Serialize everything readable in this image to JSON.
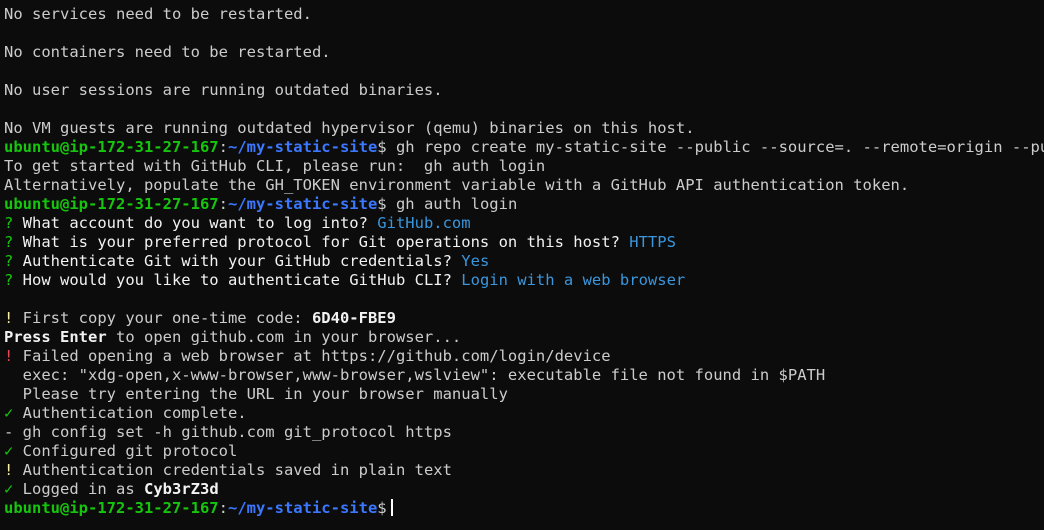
{
  "terminal": {
    "colors": {
      "text": "#cccccc",
      "prompt_user": "#16c60c",
      "prompt_path": "#3b78ff",
      "accent": "#3a96dd",
      "bright": "#f2f2f2",
      "warn": "#f9f1a5",
      "error": "#e74856"
    },
    "lines": [
      [
        {
          "t": "No services need to be restarted.",
          "c": "text"
        }
      ],
      [
        {
          "t": "",
          "c": "text"
        }
      ],
      [
        {
          "t": "No containers need to be restarted.",
          "c": "text"
        }
      ],
      [
        {
          "t": "",
          "c": "text"
        }
      ],
      [
        {
          "t": "No user sessions are running outdated binaries.",
          "c": "text"
        }
      ],
      [
        {
          "t": "",
          "c": "text"
        }
      ],
      [
        {
          "t": "No VM guests are running outdated hypervisor (qemu) binaries on this host.",
          "c": "text"
        }
      ],
      [
        {
          "t": "ubuntu@ip-172-31-27-167",
          "c": "prompt_user",
          "b": true
        },
        {
          "t": ":",
          "c": "text"
        },
        {
          "t": "~/my-static-site",
          "c": "prompt_path",
          "b": true
        },
        {
          "t": "$ gh repo create my-static-site --public --source=. --remote=origin --push",
          "c": "text"
        }
      ],
      [
        {
          "t": "To get started with GitHub CLI, please run:  gh auth login",
          "c": "text"
        }
      ],
      [
        {
          "t": "Alternatively, populate the GH_TOKEN environment variable with a GitHub API authentication token.",
          "c": "text"
        }
      ],
      [
        {
          "t": "ubuntu@ip-172-31-27-167",
          "c": "prompt_user",
          "b": true
        },
        {
          "t": ":",
          "c": "text"
        },
        {
          "t": "~/my-static-site",
          "c": "prompt_path",
          "b": true
        },
        {
          "t": "$ gh auth login",
          "c": "text"
        }
      ],
      [
        {
          "t": "? ",
          "c": "prompt_user"
        },
        {
          "t": "What account do you want to log into? ",
          "c": "bright"
        },
        {
          "t": "GitHub.com",
          "c": "accent"
        }
      ],
      [
        {
          "t": "? ",
          "c": "prompt_user"
        },
        {
          "t": "What is your preferred protocol for Git operations on this host? ",
          "c": "bright"
        },
        {
          "t": "HTTPS",
          "c": "accent"
        }
      ],
      [
        {
          "t": "? ",
          "c": "prompt_user"
        },
        {
          "t": "Authenticate Git with your GitHub credentials? ",
          "c": "bright"
        },
        {
          "t": "Yes",
          "c": "accent"
        }
      ],
      [
        {
          "t": "? ",
          "c": "prompt_user"
        },
        {
          "t": "How would you like to authenticate GitHub CLI? ",
          "c": "bright"
        },
        {
          "t": "Login with a web browser",
          "c": "accent"
        }
      ],
      [
        {
          "t": "",
          "c": "text"
        }
      ],
      [
        {
          "t": "! ",
          "c": "warn"
        },
        {
          "t": "First copy your one-time code: ",
          "c": "text"
        },
        {
          "t": "6D40-FBE9",
          "c": "bright",
          "b": true
        }
      ],
      [
        {
          "t": "Press Enter",
          "c": "bright",
          "b": true
        },
        {
          "t": " to open github.com in your browser...",
          "c": "text"
        }
      ],
      [
        {
          "t": "! ",
          "c": "error"
        },
        {
          "t": "Failed opening a web browser at https://github.com/login/device",
          "c": "text"
        }
      ],
      [
        {
          "t": "  exec: \"xdg-open,x-www-browser,www-browser,wslview\": executable file not found in $PATH",
          "c": "text"
        }
      ],
      [
        {
          "t": "  Please try entering the URL in your browser manually",
          "c": "text"
        }
      ],
      [
        {
          "t": "✓ ",
          "c": "prompt_user"
        },
        {
          "t": "Authentication complete.",
          "c": "text"
        }
      ],
      [
        {
          "t": "- gh config set -h github.com git_protocol https",
          "c": "text"
        }
      ],
      [
        {
          "t": "✓ ",
          "c": "prompt_user"
        },
        {
          "t": "Configured git protocol",
          "c": "text"
        }
      ],
      [
        {
          "t": "! ",
          "c": "warn"
        },
        {
          "t": "Authentication credentials saved in plain text",
          "c": "text"
        }
      ],
      [
        {
          "t": "✓ ",
          "c": "prompt_user"
        },
        {
          "t": "Logged in as ",
          "c": "text"
        },
        {
          "t": "Cyb3rZ3d",
          "c": "bright",
          "b": true
        }
      ],
      [
        {
          "t": "ubuntu@ip-172-31-27-167",
          "c": "prompt_user",
          "b": true
        },
        {
          "t": ":",
          "c": "text"
        },
        {
          "t": "~/my-static-site",
          "c": "prompt_path",
          "b": true
        },
        {
          "t": "$",
          "c": "text"
        }
      ]
    ]
  }
}
